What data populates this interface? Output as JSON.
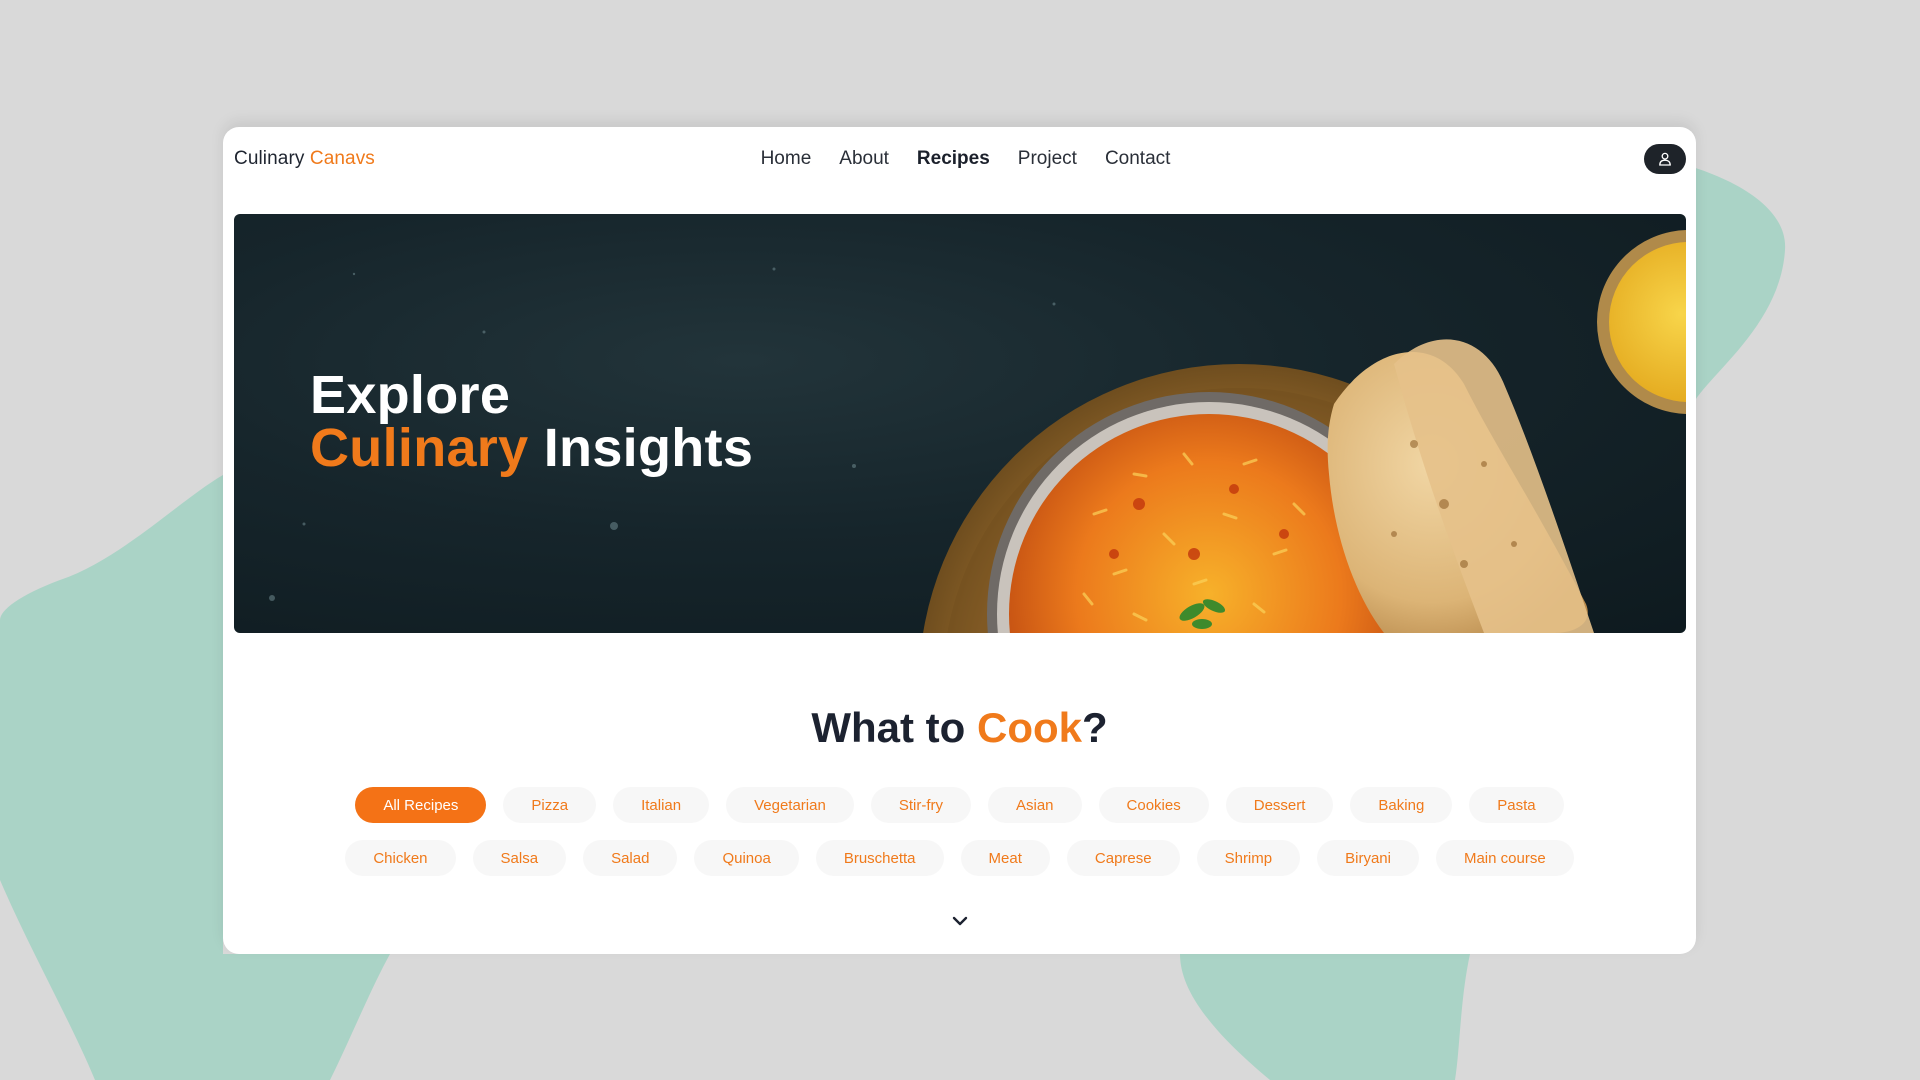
{
  "logo": {
    "part1": "Culinary",
    "part2": "Canavs"
  },
  "nav": {
    "items": [
      {
        "label": "Home"
      },
      {
        "label": "About"
      },
      {
        "label": "Recipes"
      },
      {
        "label": "Project"
      },
      {
        "label": "Contact"
      }
    ],
    "active": "Recipes"
  },
  "user_button": {
    "icon": "user-icon"
  },
  "hero": {
    "line1": "Explore",
    "line2_accent": "Culinary",
    "line2_rest": " Insights",
    "image_subject": "biryani bowl with naan and rice"
  },
  "section": {
    "title_pre": "What to ",
    "title_accent": "Cook",
    "title_post": "?"
  },
  "categories": {
    "row1": [
      "All Recipes",
      "Pizza",
      "Italian",
      "Vegetarian",
      "Stir-fry",
      "Asian",
      "Cookies",
      "Dessert",
      "Baking",
      "Pasta"
    ],
    "row2": [
      "Chicken",
      "Salsa",
      "Salad",
      "Quinoa",
      "Bruschetta",
      "Meat",
      "Caprese",
      "Shrimp",
      "Biryani",
      "Main course"
    ],
    "selected": "All Recipes"
  },
  "more_icon": "chevron-down-icon",
  "colors": {
    "accent": "#f07a1b",
    "background": "#d9d9d9",
    "blob": "#aad3c6",
    "text_dark": "#1c2230"
  }
}
